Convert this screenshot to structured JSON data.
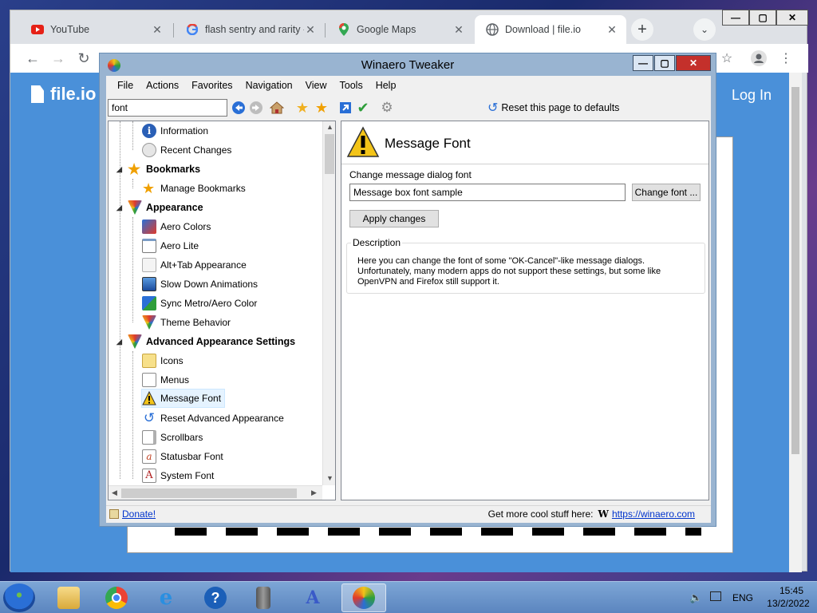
{
  "browser": {
    "tabs": [
      {
        "title": "YouTube",
        "icon": "youtube-icon",
        "active": false
      },
      {
        "title": "flash sentry and rarity -",
        "icon": "google-icon",
        "active": false
      },
      {
        "title": "Google Maps",
        "icon": "maps-icon",
        "active": false
      },
      {
        "title": "Download | file.io",
        "icon": "globe-icon",
        "active": true
      }
    ],
    "close_glyph": "✕",
    "new_tab_glyph": "+",
    "page": {
      "logo": "file.io",
      "login": "Log In"
    }
  },
  "winaero": {
    "title": "Winaero Tweaker",
    "menu": [
      "File",
      "Actions",
      "Favorites",
      "Navigation",
      "View",
      "Tools",
      "Help"
    ],
    "search_value": "font",
    "reset_label": "Reset this page to defaults",
    "tree": [
      {
        "label": "Information",
        "level": 2,
        "icon": "info-icon"
      },
      {
        "label": "Recent Changes",
        "level": 2,
        "icon": "recent-changes-icon"
      },
      {
        "label": "Bookmarks",
        "level": 1,
        "icon": "star-icon"
      },
      {
        "label": "Manage Bookmarks",
        "level": 2,
        "icon": "manage-bookmarks-icon"
      },
      {
        "label": "Appearance",
        "level": 1,
        "icon": "appearance-icon"
      },
      {
        "label": "Aero Colors",
        "level": 2,
        "icon": "aero-colors-icon"
      },
      {
        "label": "Aero Lite",
        "level": 2,
        "icon": "aero-lite-icon"
      },
      {
        "label": "Alt+Tab Appearance",
        "level": 2,
        "icon": "alt-tab-icon"
      },
      {
        "label": "Slow Down Animations",
        "level": 2,
        "icon": "animations-icon"
      },
      {
        "label": "Sync Metro/Aero Color",
        "level": 2,
        "icon": "sync-color-icon"
      },
      {
        "label": "Theme Behavior",
        "level": 2,
        "icon": "theme-icon"
      },
      {
        "label": "Advanced Appearance Settings",
        "level": 1,
        "icon": "advanced-appearance-icon"
      },
      {
        "label": "Icons",
        "level": 2,
        "icon": "icons-icon"
      },
      {
        "label": "Menus",
        "level": 2,
        "icon": "menus-icon"
      },
      {
        "label": "Message Font",
        "level": 2,
        "icon": "warning-icon",
        "selected": true
      },
      {
        "label": "Reset Advanced Appearance",
        "level": 2,
        "icon": "reset-icon"
      },
      {
        "label": "Scrollbars",
        "level": 2,
        "icon": "scrollbars-icon"
      },
      {
        "label": "Statusbar Font",
        "level": 2,
        "icon": "statusbar-font-icon"
      },
      {
        "label": "System Font",
        "level": 2,
        "icon": "system-font-icon"
      }
    ],
    "content": {
      "heading": "Message Font",
      "change_label": "Change message dialog font",
      "sample_value": "Message box font sample",
      "change_button": "Change font ...",
      "apply_button": "Apply changes",
      "description_legend": "Description",
      "description_text": "Here you can change the font of some \"OK-Cancel\"-like message dialogs. Unfortunately, many modern apps do not support these settings, but some like OpenVPN and Firefox still support it."
    },
    "status": {
      "donate": "Donate!",
      "more_text": "Get more cool stuff here:",
      "url": "https://winaero.com"
    }
  },
  "taskbar": {
    "apps": [
      "explorer-icon",
      "chrome-icon",
      "ie-icon",
      "help-icon",
      "server-icon",
      "winaero-icon",
      "winaero-tweaker-icon"
    ],
    "lang": "ENG",
    "time": "15:45",
    "date": "13/2/2022"
  },
  "colors": {
    "accent": "#2a6fd6",
    "titlebar": "#99b4d1",
    "close_red": "#c4302b",
    "page_blue": "#4a90d9"
  }
}
